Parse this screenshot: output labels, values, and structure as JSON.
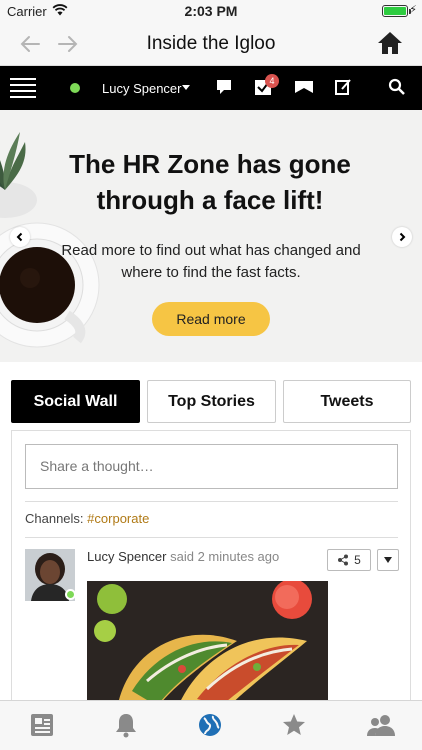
{
  "status": {
    "carrier": "Carrier",
    "time": "2:03 PM",
    "battery_level": 1.0
  },
  "nav": {
    "title": "Inside the Igloo",
    "back_icon": "back-arrow-icon",
    "forward_icon": "forward-arrow-icon",
    "home_icon": "home-icon"
  },
  "toolbar": {
    "user_name": "Lucy Spencer",
    "presence_color": "#7ed957",
    "tasks_badge": "4",
    "icons": [
      "menu-icon",
      "chat-icon",
      "tasks-icon",
      "inbox-icon",
      "edit-icon",
      "search-icon"
    ]
  },
  "hero": {
    "headline": "The HR Zone has gone through a face lift!",
    "subtext": "Read more to find out what has changed and where to find the fast facts.",
    "button_label": "Read more",
    "accent": "#f6c544"
  },
  "tabs": [
    {
      "label": "Social Wall",
      "active": true
    },
    {
      "label": "Top Stories",
      "active": false
    },
    {
      "label": "Tweets",
      "active": false
    }
  ],
  "wall": {
    "share_placeholder": "Share a thought…",
    "channels_label": "Channels:",
    "channel_tag": "#corporate",
    "post": {
      "author": "Lucy Spencer",
      "time_text": "said 2 minutes ago",
      "share_count": "5"
    }
  },
  "tabbar": {
    "items": [
      "articles-icon",
      "notifications-icon",
      "globe-icon",
      "favorites-icon",
      "people-icon"
    ],
    "active_color": "#1f6fb5",
    "inactive_color": "#8a8a8a"
  }
}
